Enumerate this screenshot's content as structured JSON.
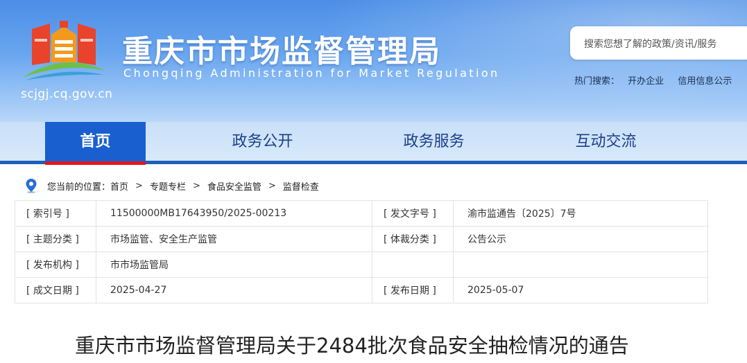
{
  "header": {
    "domain": "scjgj.cq.gov.cn",
    "title_cn": "重庆市市场监督管理局",
    "title_en": "Chongqing  Administration for Market Regulation",
    "search_placeholder": "搜索您想了解的政策/资讯/服务",
    "hot_label": "热门搜索：",
    "hot_items": [
      "开办企业",
      "信用信息公示"
    ]
  },
  "nav": {
    "items": [
      {
        "label": "首页"
      },
      {
        "label": "政务公开"
      },
      {
        "label": "政务服务"
      },
      {
        "label": "互动交流"
      }
    ],
    "active_index": 0
  },
  "breadcrumb": {
    "prefix": "您当前的位置：",
    "items": [
      "首页",
      "专题专栏",
      "食品安全监管",
      "监督检查"
    ],
    "separator": ">"
  },
  "info": {
    "rows": [
      {
        "l1": "[ 索引号 ]",
        "v1": "11500000MB17643950/2025-00213",
        "l2": "[ 发文字号 ]",
        "v2": "渝市监通告〔2025〕7号"
      },
      {
        "l1": "[ 主题分类 ]",
        "v1": "市场监管、安全生产监管",
        "l2": "[ 体裁分类 ]",
        "v2": "公告公示"
      },
      {
        "l1": "[ 发布机构 ]",
        "v1": "市市场监管局",
        "l2": "",
        "v2": ""
      },
      {
        "l1": "[ 成文日期 ]",
        "v1": "2025-04-27",
        "l2": "[ 发布日期 ]",
        "v2": "2025-05-07"
      }
    ]
  },
  "article": {
    "title": "重庆市市场监督管理局关于2484批次食品安全抽检情况的通告"
  },
  "colors": {
    "nav_active": "#1a5fcf",
    "nav_active_border": "#e4161c",
    "nav_text": "#1a3f8a",
    "header_blue": "#4b8ee6"
  }
}
